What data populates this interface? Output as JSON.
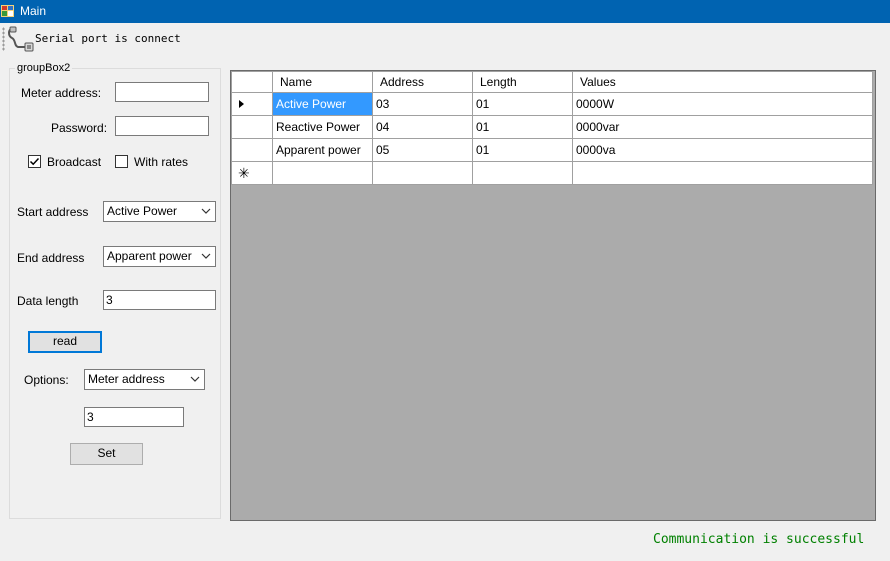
{
  "window": {
    "title": "Main"
  },
  "toolbar": {
    "status_text": "Serial port is connect"
  },
  "group": {
    "title": "groupBox2",
    "meter_address_label": "Meter address:",
    "meter_address_value": "",
    "password_label": "Password:",
    "password_value": "",
    "broadcast_label": "Broadcast",
    "broadcast_checked": true,
    "with_rates_label": "With rates",
    "with_rates_checked": false,
    "start_address_label": "Start address",
    "start_address_value": "Active Power",
    "end_address_label": "End address",
    "end_address_value": "Apparent power",
    "data_length_label": "Data length",
    "data_length_value": "3",
    "read_label": "read",
    "options_label": "Options:",
    "options_value": "Meter address",
    "options_input_value": "3",
    "set_label": "Set"
  },
  "grid": {
    "columns": [
      "Name",
      "Address",
      "Length",
      "Values"
    ],
    "rows": [
      {
        "name": "Active Power",
        "address": "03",
        "length": "01",
        "value": "0000W"
      },
      {
        "name": "Reactive Power",
        "address": "04",
        "length": "01",
        "value": "0000var"
      },
      {
        "name": "Apparent power",
        "address": "05",
        "length": "01",
        "value": "0000va"
      }
    ],
    "new_row_glyph": "✳",
    "selection_color": "#3399ff"
  },
  "status": {
    "message": "Communication is successful",
    "color": "#008000"
  },
  "colors": {
    "titlebar": "#0063b1",
    "focus_border": "#0078d7"
  }
}
